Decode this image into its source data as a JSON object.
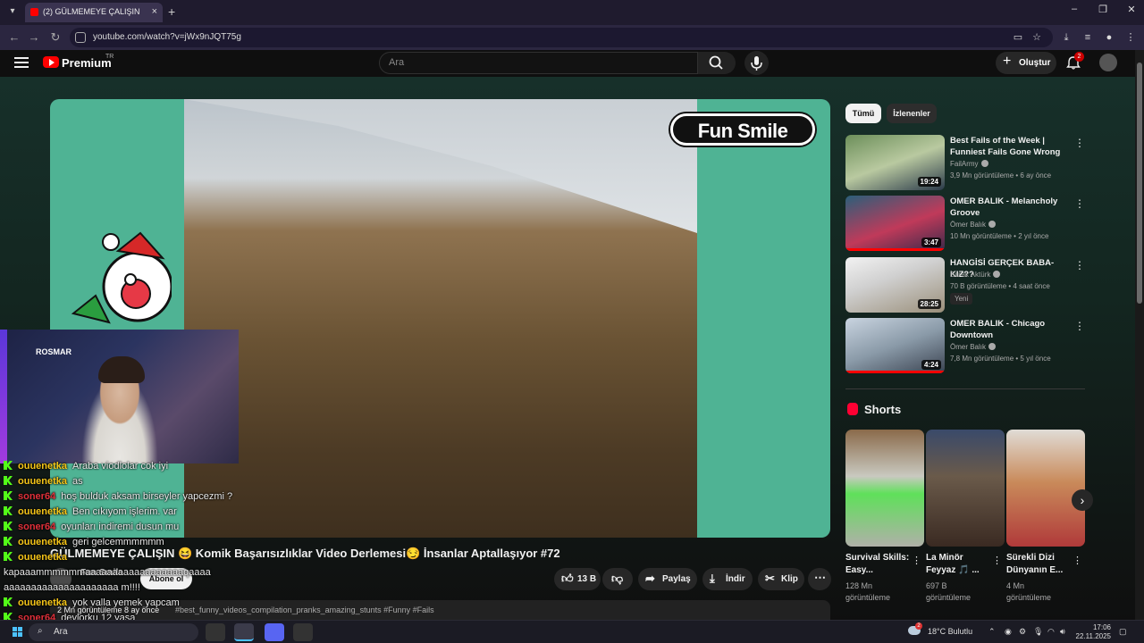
{
  "browser": {
    "tab_title": "(2) GÜLMEMEYE ÇALIŞIN 😆 🔊",
    "tab_list_icon": "chevron-down-icon",
    "url": "youtube.com/watch?v=jWx9nJQT75g"
  },
  "header": {
    "brand": "Premium",
    "region": "TR",
    "search_placeholder": "Ara",
    "create_label": "Oluştur",
    "notification_count": "2"
  },
  "player": {
    "overlay_brand": "Fun Smile"
  },
  "webcam": {
    "sign": "ROSMAR"
  },
  "chat": {
    "messages": [
      {
        "user": "ouuenetka",
        "text": "Araba viodlolar cok iyi",
        "color": "#f5c518"
      },
      {
        "user": "ouuenetka",
        "text": "as",
        "color": "#f5c518"
      },
      {
        "user": "soner64",
        "text": "hoş bulduk aksam birseyler yapcezmi ?",
        "color": "#e0303a"
      },
      {
        "user": "ouuenetka",
        "text": "Ben cıkıyom işlerim. var",
        "color": "#f5c518"
      },
      {
        "user": "soner64",
        "text": "oyunları indiremi dusun mu",
        "color": "#e0303a"
      },
      {
        "user": "ouuenetka",
        "text": "geri gelcemmmmmm",
        "color": "#f5c518"
      },
      {
        "user": "ouuenetka",
        "text": "",
        "color": "#f5c518"
      },
      {
        "user": "",
        "text": "kapaaammmmmmaaaaaaaaaaaaaaaaaaqaaaa",
        "color": "#f5c518"
      },
      {
        "user": "",
        "text": "aaaaaaaaaaaaaaaaaaaaa m!!!!",
        "color": "#f5c518"
      },
      {
        "user": "ouuenetka",
        "text": "yok valla yemek yapcam",
        "color": "#f5c518"
      },
      {
        "user": "soner64",
        "text": "devlorku 12 yaşa",
        "color": "#e0303a"
      }
    ]
  },
  "video": {
    "title": "GÜLMEMEYE ÇALIŞIN 😆 Komik Başarısızlıklar Video Derlemesi😏 İnsanlar Aptallaşıyor #72",
    "channel": "Fun Smile",
    "subscribe": "Abone ol",
    "likes": "13 B",
    "share": "Paylaş",
    "download": "İndir",
    "clip": "Klip",
    "description_meta": "2 Mn görüntüleme 8 ay önce",
    "description_tags": "#best_funny_videos_compilation_pranks_amazing_stunts #Funny #Fails"
  },
  "sidebar": {
    "chips": [
      "Tümü",
      "İzlenenler"
    ],
    "recommendations": [
      {
        "title": "Best Fails of the Week | Funniest Fails Gone Wrong",
        "channel": "FailArmy",
        "views": "3,9 Mn görüntüleme",
        "age": "6 ay önce",
        "duration": "19:24",
        "badge": "",
        "progress": 0
      },
      {
        "title": "OMER BALIK - Melancholy Groove",
        "channel": "Ömer Balık",
        "views": "10 Mn görüntüleme",
        "age": "2 yıl önce",
        "duration": "3:47",
        "badge": "",
        "progress": 1
      },
      {
        "title": "HANGİSİ GERÇEK BABA- KIZ??",
        "channel": "Burak Aktürk",
        "views": "70 B görüntüleme",
        "age": "4 saat önce",
        "duration": "28:25",
        "badge": "Yeni",
        "progress": 0
      },
      {
        "title": "OMER BALIK - Chicago Downtown",
        "channel": "Ömer Balık",
        "views": "7,8 Mn görüntüleme",
        "age": "5 yıl önce",
        "duration": "4:24",
        "badge": "",
        "progress": 1
      }
    ],
    "shorts_heading": "Shorts",
    "shorts": [
      {
        "title": "Survival Skills: Easy...",
        "views": "128 Mn",
        "views_label": "görüntüleme"
      },
      {
        "title": "La Minör Feyyaz 🎵 ...",
        "views": "697 B",
        "views_label": "görüntüleme"
      },
      {
        "title": "Sürekli Dizi Dünyanın E...",
        "views": "4 Mn",
        "views_label": "görüntüleme"
      }
    ]
  },
  "taskbar": {
    "search_label": "Ara",
    "weather": "18°C Bulutlu",
    "weather_badge": "2",
    "time": "17:06",
    "date": "22.11.2025"
  }
}
